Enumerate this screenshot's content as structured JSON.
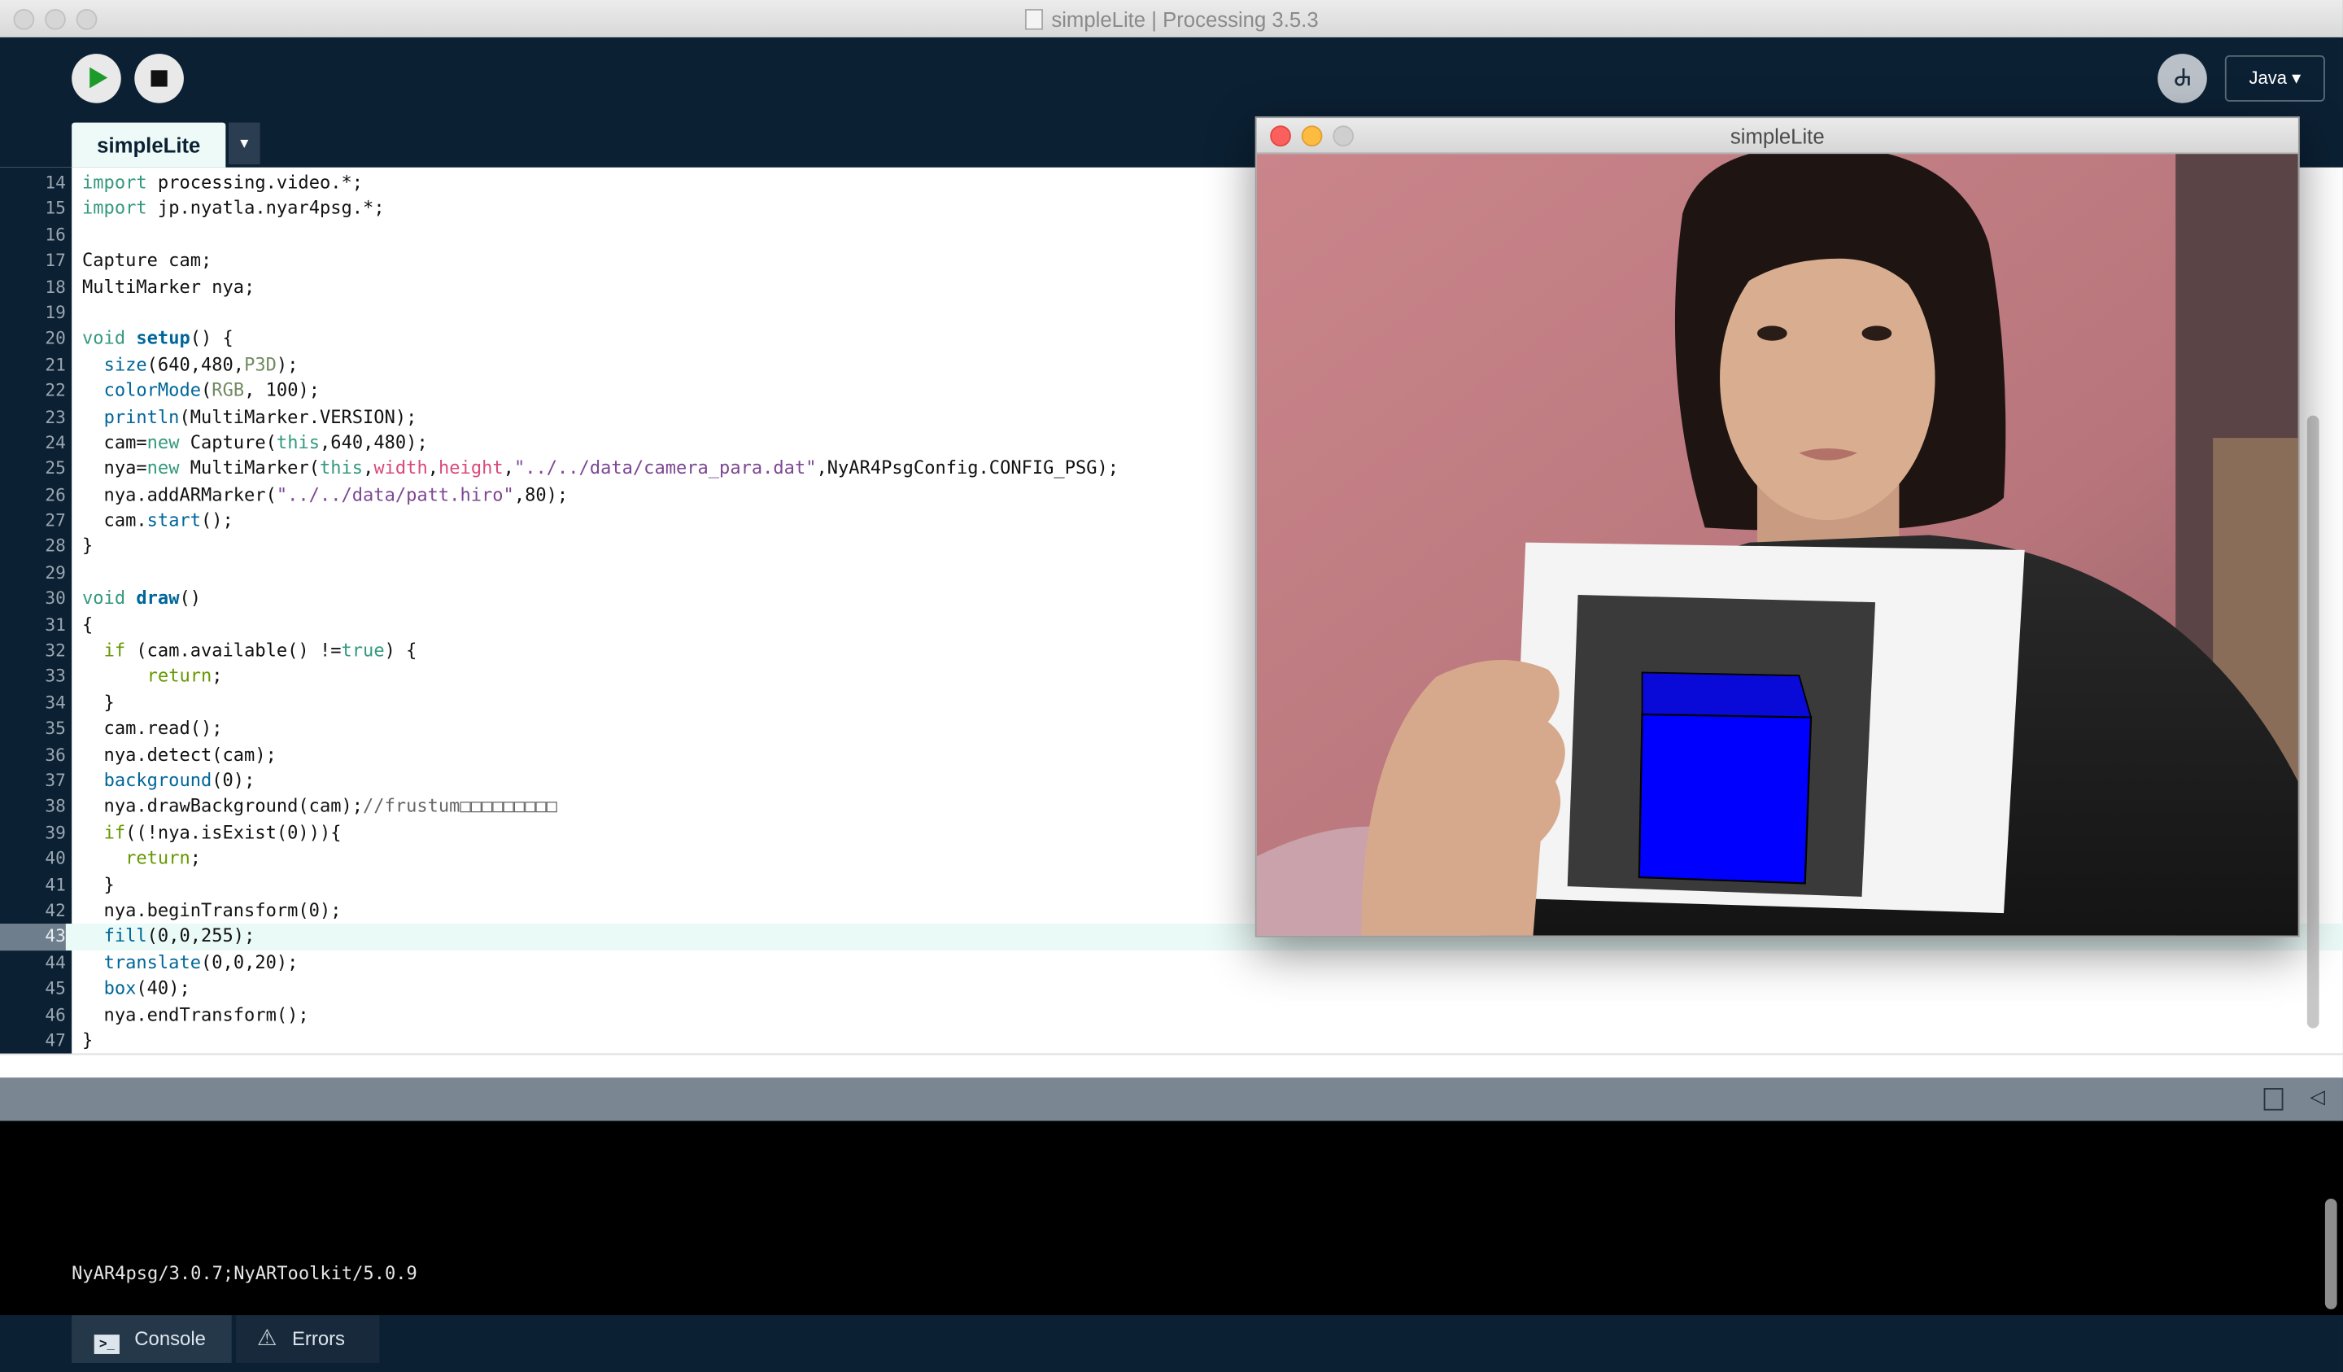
{
  "window": {
    "title": "simpleLite | Processing 3.5.3"
  },
  "toolbar": {
    "run_icon": "play-icon",
    "stop_icon": "stop-icon",
    "debug_icon": "debugger-icon",
    "debug_glyph": "ꕈ",
    "mode": "Java ▾"
  },
  "editor": {
    "tab": "simpleLite",
    "tab_menu": "▾",
    "highlighted_line": "43",
    "lines": [
      {
        "n": "14",
        "html": "<span style='color:#33997e'>import</span> processing.video.*;"
      },
      {
        "n": "15",
        "html": "<span style='color:#33997e'>import</span> jp.nyatla.nyar4psg.*;"
      },
      {
        "n": "16",
        "html": ""
      },
      {
        "n": "17",
        "html": "Capture cam;"
      },
      {
        "n": "18",
        "html": "MultiMarker nya;"
      },
      {
        "n": "19",
        "html": ""
      },
      {
        "n": "20",
        "html": "<span style='color:#33997e'>void</span> <b style='color:#006699'>setup</b>() {"
      },
      {
        "n": "21",
        "html": "  <span style='color:#006699'>size</span>(640,480,<span style='color:#718a62'>P3D</span>);"
      },
      {
        "n": "22",
        "html": "  <span style='color:#006699'>colorMode</span>(<span style='color:#718a62'>RGB</span>, 100);"
      },
      {
        "n": "23",
        "html": "  <span style='color:#006699'>println</span>(MultiMarker.VERSION);"
      },
      {
        "n": "24",
        "html": "  cam=<span style='color:#33997e'>new</span> Capture(<span style='color:#33997e'>this</span>,640,480);"
      },
      {
        "n": "25",
        "html": "  nya=<span style='color:#33997e'>new</span> MultiMarker(<span style='color:#33997e'>this</span>,<span style='color:#d94a7a'>width</span>,<span style='color:#d94a7a'>height</span>,<span style='color:#7d4793'>\"../../data/camera_para.dat\"</span>,NyAR4PsgConfig.CONFIG_PSG);"
      },
      {
        "n": "26",
        "html": "  nya.addARMarker(<span style='color:#7d4793'>\"../../data/patt.hiro\"</span>,80);"
      },
      {
        "n": "27",
        "html": "  cam.<span style='color:#006699'>start</span>();"
      },
      {
        "n": "28",
        "html": "}"
      },
      {
        "n": "29",
        "html": ""
      },
      {
        "n": "30",
        "html": "<span style='color:#33997e'>void</span> <b style='color:#006699'>draw</b>()"
      },
      {
        "n": "31",
        "html": "{"
      },
      {
        "n": "32",
        "html": "  <span style='color:#669900'>if</span> (cam.available() !=<span style='color:#33997e'>true</span>) {"
      },
      {
        "n": "33",
        "html": "      <span style='color:#669900'>return</span>;"
      },
      {
        "n": "34",
        "html": "  }"
      },
      {
        "n": "35",
        "html": "  cam.read();"
      },
      {
        "n": "36",
        "html": "  nya.detect(cam);"
      },
      {
        "n": "37",
        "html": "  <span style='color:#006699'>background</span>(0);"
      },
      {
        "n": "38",
        "html": "  nya.drawBackground(cam);<span style='color:#666666'>//frustum□□□□□□□□□</span>"
      },
      {
        "n": "39",
        "html": "  <span style='color:#669900'>if</span>((!nya.isExist(0))){"
      },
      {
        "n": "40",
        "html": "    <span style='color:#669900'>return</span>;"
      },
      {
        "n": "41",
        "html": "  }"
      },
      {
        "n": "42",
        "html": "  nya.beginTransform(0);"
      },
      {
        "n": "43",
        "html": "  <span style='color:#006699'>fill</span>(0,0,255);"
      },
      {
        "n": "44",
        "html": "  <span style='color:#006699'>translate</span>(0,0,20);"
      },
      {
        "n": "45",
        "html": "  <span style='color:#006699'>box</span>(40);"
      },
      {
        "n": "46",
        "html": "  nya.endTransform();"
      },
      {
        "n": "47",
        "html": "}"
      }
    ]
  },
  "sketch": {
    "title": "simpleLite",
    "content": "webcam frame: person holding an AR marker card with a blue cube rendered on it",
    "cube_color": "#0000ff"
  },
  "console": {
    "output": "NyAR4psg/3.0.7;NyARToolkit/5.0.9",
    "tab_console": "Console",
    "tab_errors": "Errors",
    "console_glyph": ">_",
    "errors_glyph": "⚠",
    "copy_icon": "copy-icon",
    "collapse_glyph": "◁"
  }
}
